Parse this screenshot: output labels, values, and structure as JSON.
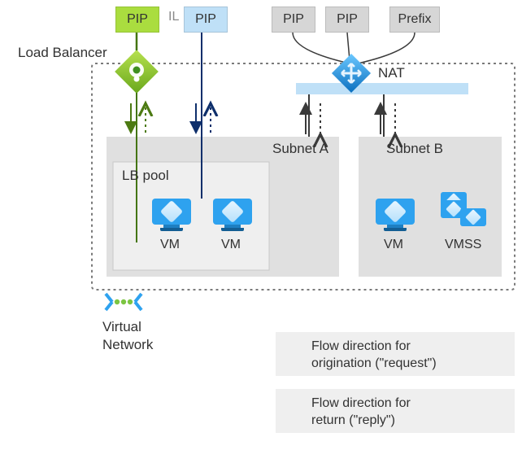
{
  "labels": {
    "load_balancer": "Load Balancer",
    "il": "IL",
    "nat": "NAT",
    "subnet_a": "Subnet A",
    "subnet_b": "Subnet B",
    "lb_pool": "LB pool",
    "vm1": "VM",
    "vm2": "VM",
    "vm3": "VM",
    "vmss": "VMSS",
    "virtual_network": "Virtual\nNetwork"
  },
  "top_boxes": {
    "pip_green": "PIP",
    "pip_blue": "PIP",
    "pip_gray1": "PIP",
    "pip_gray2": "PIP",
    "prefix": "Prefix"
  },
  "legend": {
    "request": "Flow direction for\norigination (\"request\")",
    "reply": "Flow direction for\nreturn (\"reply\")"
  },
  "colors": {
    "green_fill": "#aadd3f",
    "green_dark": "#5fa21b",
    "blue_light": "#bfe0f7",
    "azure_blue": "#2ea2ef",
    "azure_blue_dark": "#0a6fbf",
    "gray_box": "#d6d6d6",
    "panel_gray": "#e0e0e0",
    "panel_light": "#efefef",
    "dotted": "#6e6e6e",
    "navy": "#0e2f6b"
  }
}
